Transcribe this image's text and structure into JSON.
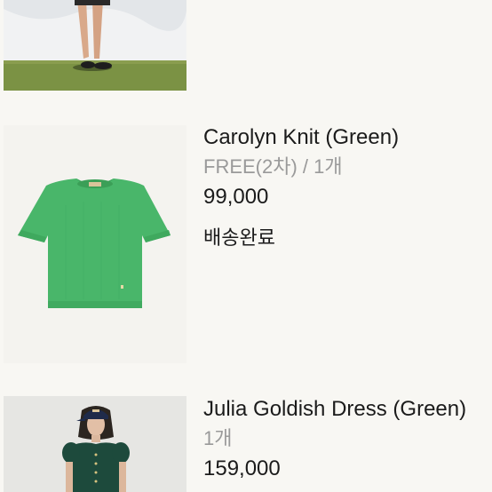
{
  "orders": [
    {
      "name": "",
      "option": "",
      "price": "",
      "status": "",
      "image": "model-legs-photo"
    },
    {
      "name": "Carolyn Knit (Green)",
      "option": "FREE(2차) / 1개",
      "price": "99,000",
      "status": "배송완료",
      "image": "green-knit-photo"
    },
    {
      "name": "Julia Goldish Dress (Green)",
      "option": "1개",
      "price": "159,000",
      "status": "",
      "image": "model-dress-photo"
    }
  ],
  "colors": {
    "background": "#f8f7f3",
    "text": "#1b1b1b",
    "muted": "#9a9a9a",
    "knit": "#49b66a"
  }
}
